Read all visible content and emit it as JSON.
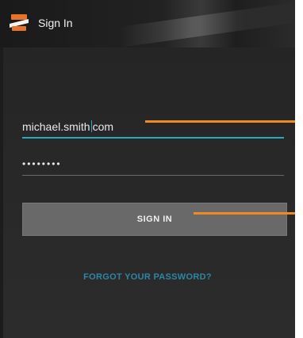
{
  "header": {
    "title": "Sign In",
    "icon": "app-logo-icon"
  },
  "form": {
    "email_value": "michael.smithcom",
    "email_value_before_cursor": "michael.smith",
    "email_value_after_cursor": "com",
    "password_mask": "••••••••",
    "signin_label": "SIGN IN",
    "forgot_label": "FORGOT YOUR PASSWORD?"
  },
  "colors": {
    "accent": "#2aa9c4",
    "callout": "#f08a24",
    "brand_orange": "#e8742a",
    "button_bg": "#696969"
  }
}
